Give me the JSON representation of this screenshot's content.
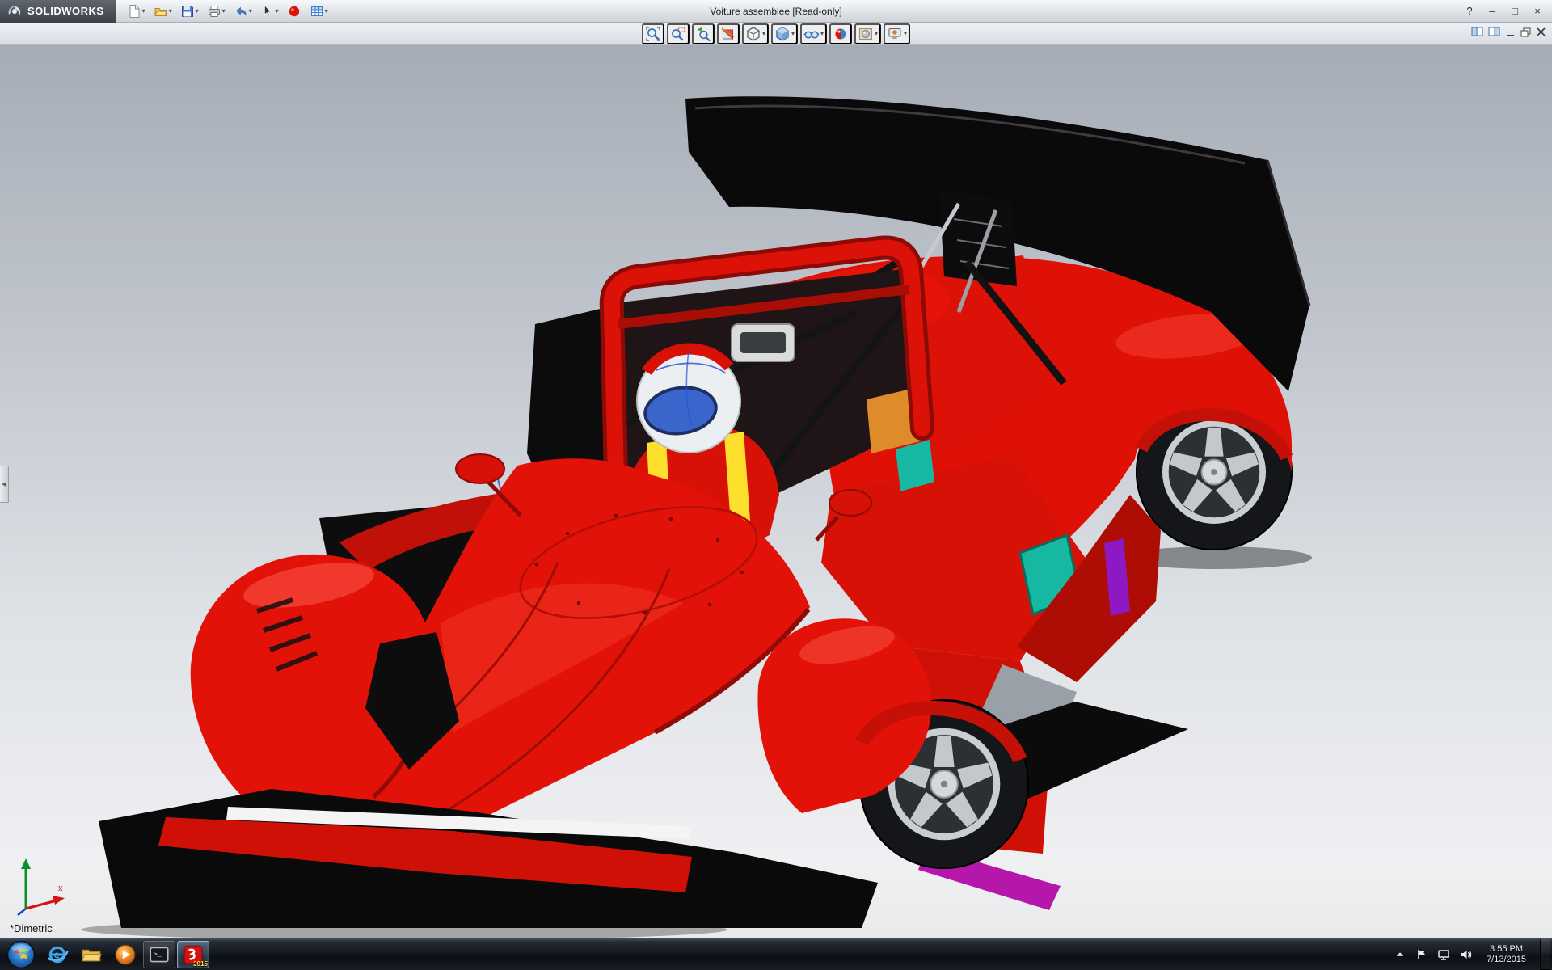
{
  "glyphs": {
    "dropdown_caret": "▾",
    "help": "?",
    "minimize": "–",
    "maximize": "□",
    "close": "×",
    "pane_arrow": "◀",
    "internet_explorer": "e",
    "prompt": ">_"
  },
  "window": {
    "brand": "SOLIDWORKS",
    "title": "Voiture assemblee [Read-only]"
  },
  "main_toolbar": {
    "items": [
      "new-document",
      "open",
      "save",
      "print",
      "undo",
      "select",
      "edit-color",
      "design-table"
    ]
  },
  "view_toolbar": {
    "items": [
      "zoom-to-fit",
      "zoom-to-area",
      "previous-view",
      "section-view",
      "view-orientation",
      "display-style",
      "hide-show-items",
      "edit-appearance",
      "apply-scene",
      "view-settings"
    ]
  },
  "viewport": {
    "orientation_label": "*Dimetric",
    "triad_x_label": "x",
    "background_top": "#a6acb6",
    "background_bottom": "#eff0f2",
    "car_primary": "#e31208",
    "wing_color": "#0a0a0b"
  },
  "taskbar": {
    "items": [
      "start",
      "internet-explorer",
      "windows-explorer",
      "media-player",
      "command-prompt",
      "solidworks-2015"
    ],
    "sw_badge": "2015",
    "tray": {
      "time": "3:55 PM",
      "date": "7/13/2015"
    }
  }
}
